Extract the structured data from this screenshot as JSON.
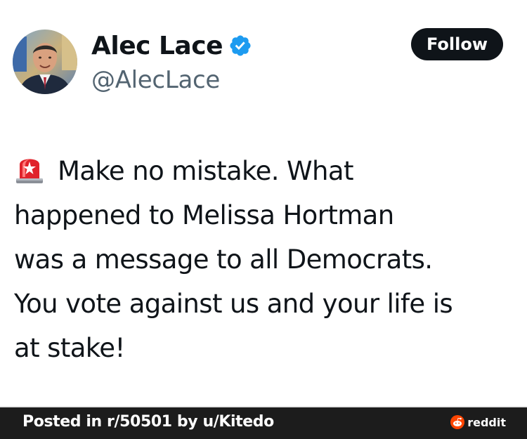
{
  "tweet": {
    "display_name": "Alec Lace",
    "handle": "@AlecLace",
    "follow_label": "Follow",
    "verified_icon": "verified-badge-icon",
    "emoji": "rotating-light-siren",
    "lines": [
      "Make no mistake.  What",
      "happened to Melissa Hortman",
      "was a message to all Democrats.",
      "You vote against us and your life is",
      "at stake!"
    ]
  },
  "footer": {
    "posted_text": "Posted in r/50501 by u/Kitedo",
    "brand_label": "reddit",
    "brand_icon": "reddit-snoo-icon"
  },
  "colors": {
    "verified_blue": "#1d9bf0",
    "follow_bg": "#0f1419",
    "handle_gray": "#536471",
    "footer_bg": "#1c1c1c",
    "reddit_orange": "#ff4500"
  }
}
